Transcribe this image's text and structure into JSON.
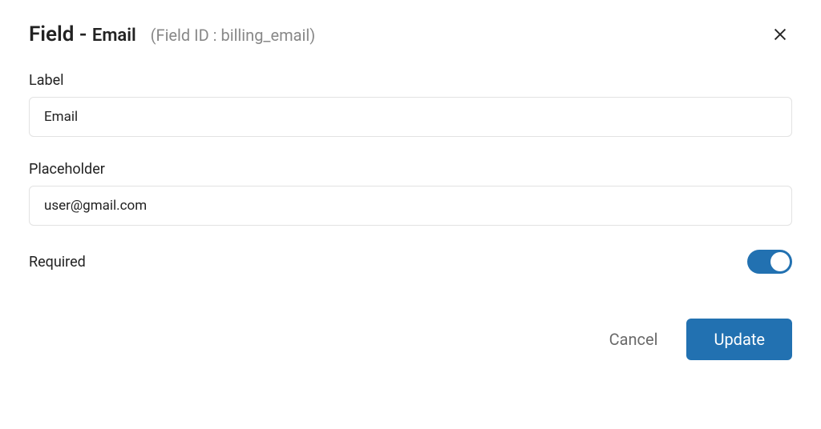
{
  "header": {
    "title_prefix": "Field",
    "separator": " - ",
    "field_name": "Email",
    "field_id_label": "(Field ID : billing_email)"
  },
  "form": {
    "label": {
      "caption": "Label",
      "value": "Email"
    },
    "placeholder": {
      "caption": "Placeholder",
      "value": "user@gmail.com"
    },
    "required": {
      "caption": "Required",
      "enabled": true
    }
  },
  "footer": {
    "cancel": "Cancel",
    "update": "Update"
  }
}
